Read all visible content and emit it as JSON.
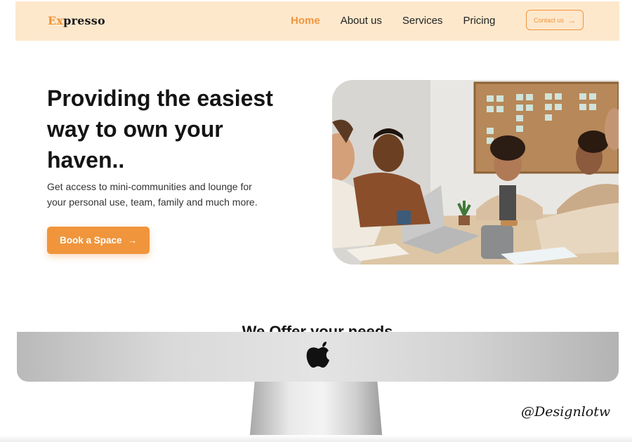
{
  "brand": {
    "logo_accent": "Ex",
    "logo_rest": "presso",
    "accent_color": "#f0953c",
    "nav_bg": "#fde8cc"
  },
  "nav": {
    "items": [
      {
        "label": "Home",
        "active": true
      },
      {
        "label": "About us",
        "active": false
      },
      {
        "label": "Services",
        "active": false
      },
      {
        "label": "Pricing",
        "active": false
      }
    ],
    "contact_label": "Contact us",
    "contact_icon": "arrow-right-icon"
  },
  "hero": {
    "title_line1": "Providing the easiest",
    "title_line2": "way to own your",
    "title_line3": "haven..",
    "subtitle_line1": "Get access to mini-communities and lounge for",
    "subtitle_line2": "your personal use, team, family and much more.",
    "cta_label": "Book a Space",
    "cta_icon": "arrow-right-icon",
    "image_icon": "team-meeting-photo"
  },
  "section": {
    "heading": "We Offer your needs"
  },
  "device": {
    "logo_icon": "apple-logo-icon"
  },
  "watermark": "@Designlotw"
}
